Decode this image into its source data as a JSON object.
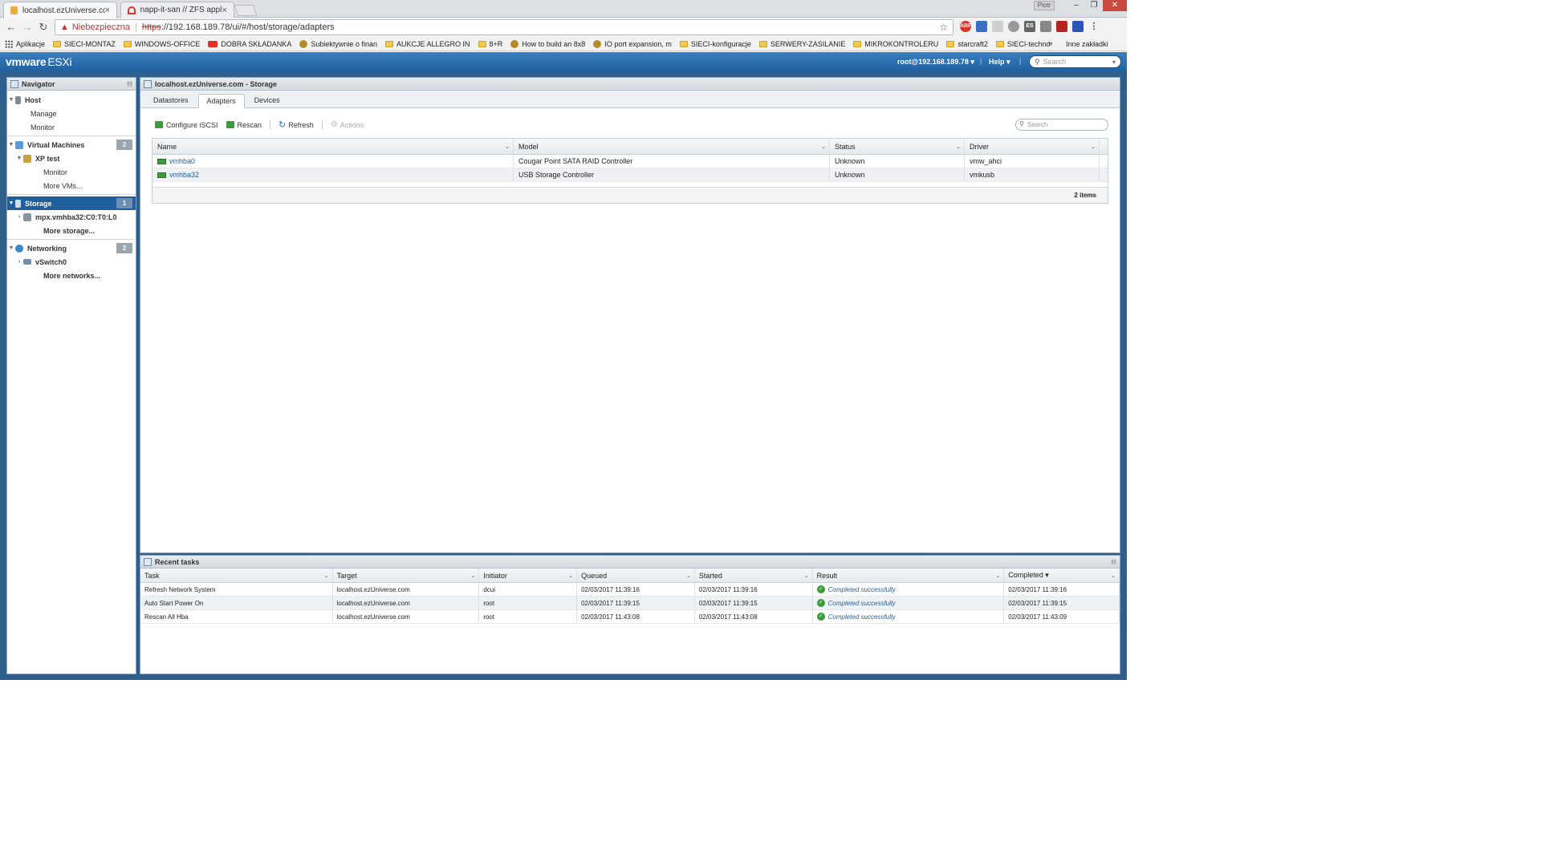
{
  "browser": {
    "tabs": [
      {
        "label": "localhost.ezUniverse.com",
        "active": true
      },
      {
        "label": "napp-it-san // ZFS applic",
        "active": false
      }
    ],
    "address": {
      "warning_label": "Niebezpieczna",
      "scheme": "https",
      "rest": "://192.168.189.78/ui/#/host/storage/adapters"
    },
    "bookmarks": [
      {
        "label": "Aplikacje",
        "icon": "apps-icon"
      },
      {
        "label": "SIECI-MONTAZ",
        "icon": "folder-icon"
      },
      {
        "label": "WINDOWS-OFFICE",
        "icon": "folder-icon"
      },
      {
        "label": "DOBRA SKŁADANKA",
        "icon": "youtube-icon"
      },
      {
        "label": "Subiektywnie o finan",
        "icon": "site-icon"
      },
      {
        "label": "AUKCJE ALLEGRO IN",
        "icon": "folder-icon"
      },
      {
        "label": "8+R",
        "icon": "folder-icon"
      },
      {
        "label": "How to build an 8x8",
        "icon": "site-icon"
      },
      {
        "label": "IO port expansion, m",
        "icon": "site-icon"
      },
      {
        "label": "SIECI-konfiguracje",
        "icon": "folder-icon"
      },
      {
        "label": "SERWERY-ZASILANIE",
        "icon": "folder-icon"
      },
      {
        "label": "MIKROKONTROLERU",
        "icon": "folder-icon"
      },
      {
        "label": "starcraft2",
        "icon": "folder-icon"
      },
      {
        "label": "SIECI-techno",
        "icon": "folder-icon"
      }
    ],
    "bookmarks_more": "»",
    "bookmarks_other": "Inne zakładki"
  },
  "esxi": {
    "logo_vmware": "vmware",
    "logo_esxi": "ESXi",
    "user": "root@192.168.189.78 ▾",
    "help": "Help ▾",
    "search_placeholder": "Search"
  },
  "navigator": {
    "title": "Navigator",
    "items": [
      {
        "label": "Host",
        "level": 0
      },
      {
        "label": "Manage",
        "level": 1
      },
      {
        "label": "Monitor",
        "level": 1
      },
      {
        "label": "Virtual Machines",
        "level": 0,
        "badge": "2"
      },
      {
        "label": "XP test",
        "level": 1
      },
      {
        "label": "Monitor",
        "level": 2
      },
      {
        "label": "More VMs...",
        "level": 2
      },
      {
        "label": "Storage",
        "level": 0,
        "badge": "1"
      },
      {
        "label": "mpx.vmhba32:C0:T0:L0",
        "level": 1
      },
      {
        "label": "More storage...",
        "level": 2
      },
      {
        "label": "Networking",
        "level": 0,
        "badge": "2"
      },
      {
        "label": "vSwitch0",
        "level": 1
      },
      {
        "label": "More networks...",
        "level": 2
      }
    ]
  },
  "main": {
    "title": "localhost.ezUniverse.com - Storage",
    "tabs": [
      "Datastores",
      "Adapters",
      "Devices"
    ],
    "active_tab": "Adapters",
    "actions": {
      "configure_iscsi": "Configure iSCSI",
      "rescan": "Rescan",
      "refresh": "Refresh",
      "actions": "Actions"
    },
    "search_placeholder": "Search",
    "columns": [
      "Name",
      "Model",
      "Status",
      "Driver"
    ],
    "rows": [
      {
        "name": "vmhba0",
        "model": "Cougar Point SATA RAID Controller",
        "status": "Unknown",
        "driver": "vmw_ahci"
      },
      {
        "name": "vmhba32",
        "model": "USB Storage Controller",
        "status": "Unknown",
        "driver": "vmkusb"
      }
    ],
    "footer": "2 items"
  },
  "tasks": {
    "title": "Recent tasks",
    "columns": [
      "Task",
      "Target",
      "Initiator",
      "Queued",
      "Started",
      "Result",
      "Completed ▾"
    ],
    "rows": [
      {
        "task": "Refresh Network System",
        "target": "localhost.ezUniverse.com",
        "initiator": "dcui",
        "queued": "02/03/2017 11:39:16",
        "started": "02/03/2017 11:39:16",
        "result": "Completed successfully",
        "completed": "02/03/2017 11:39:16"
      },
      {
        "task": "Auto Start Power On",
        "target": "localhost.ezUniverse.com",
        "initiator": "root",
        "queued": "02/03/2017 11:39:15",
        "started": "02/03/2017 11:39:15",
        "result": "Completed successfully",
        "completed": "02/03/2017 11:39:15"
      },
      {
        "task": "Rescan All Hba",
        "target": "localhost.ezUniverse.com",
        "initiator": "root",
        "queued": "02/03/2017 11:43:08",
        "started": "02/03/2017 11:43:08",
        "result": "Completed successfully",
        "completed": "02/03/2017 11:43:09"
      }
    ]
  },
  "colors": {
    "header_blue": "#1f5f9e",
    "selection_blue": "#1f5f9e",
    "success_green": "#3a9b3a"
  }
}
